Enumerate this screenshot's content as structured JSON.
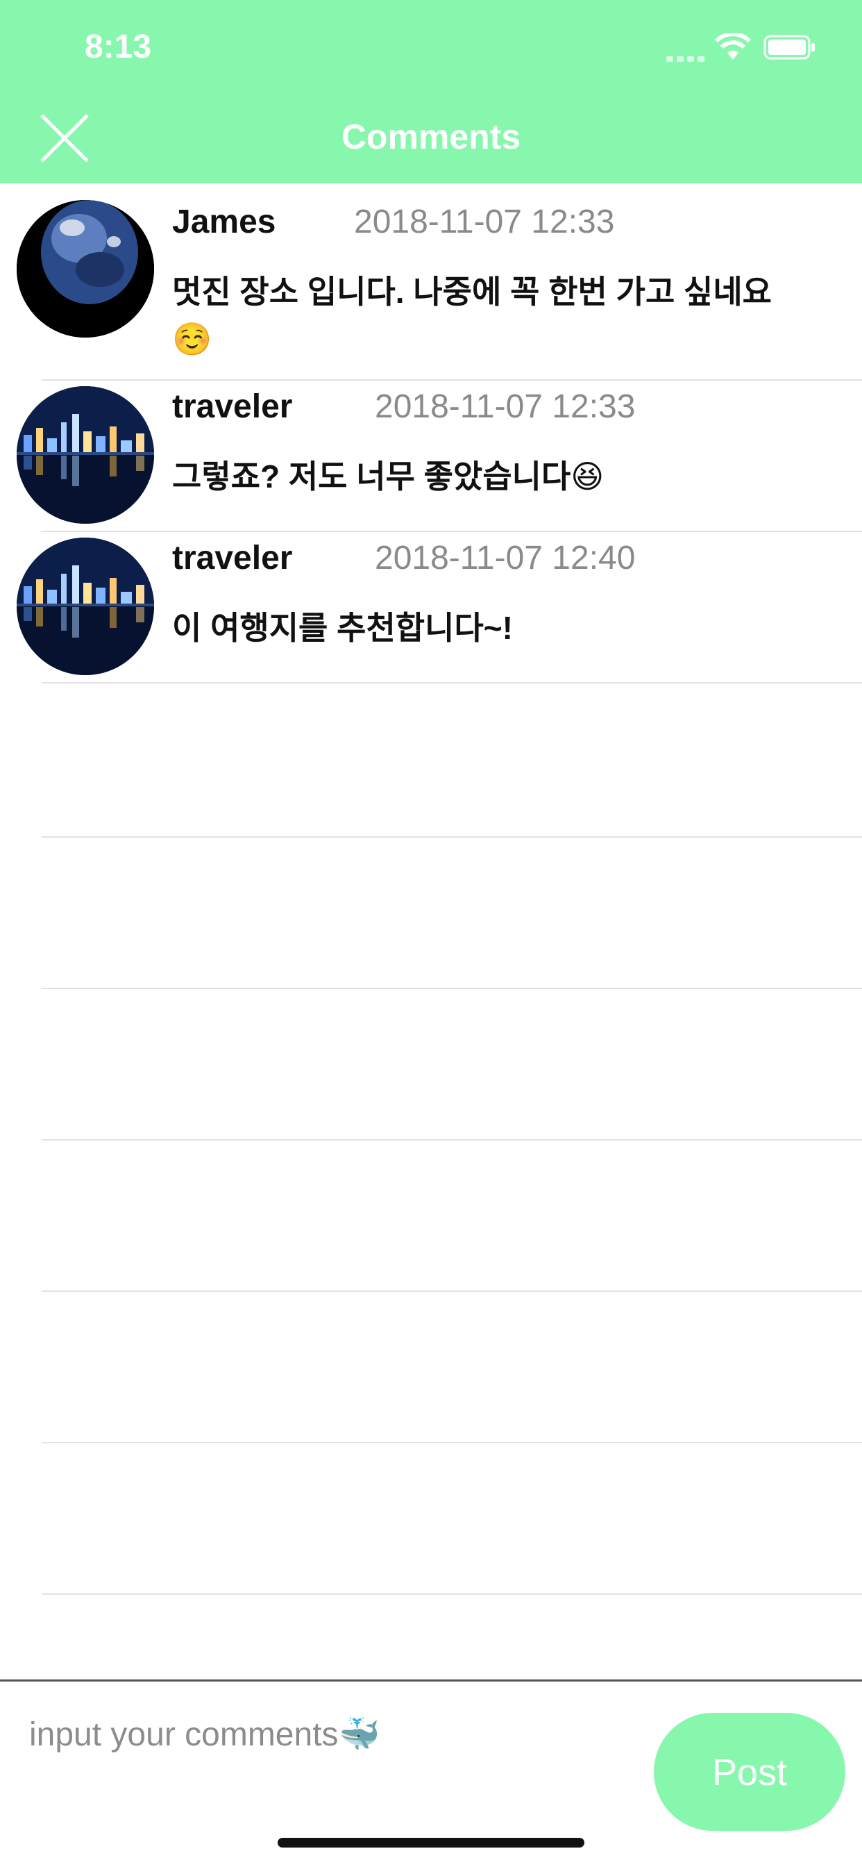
{
  "status_bar": {
    "time": "8:13"
  },
  "header": {
    "title": "Comments",
    "close_icon": "close-icon"
  },
  "comments": [
    {
      "user": "James",
      "date": "2018-11-07 12:33",
      "text": "멋진 장소 입니다. 나중에 꼭 한번 가고 싶네요☺️",
      "avatar": "earth-avatar"
    },
    {
      "user": "traveler",
      "date": "2018-11-07 12:33",
      "text": "그렇죠? 저도 너무 좋았습니다😆",
      "avatar": "city-night-avatar"
    },
    {
      "user": "traveler",
      "date": "2018-11-07 12:40",
      "text": "이 여행지를 추천합니다~!",
      "avatar": "city-night-avatar"
    }
  ],
  "composer": {
    "placeholder": "input your comments🐳",
    "post_label": "Post"
  },
  "colors": {
    "accent": "#87f7ae",
    "date_text": "#8a8a8a",
    "separator": "#e2e2e2"
  }
}
